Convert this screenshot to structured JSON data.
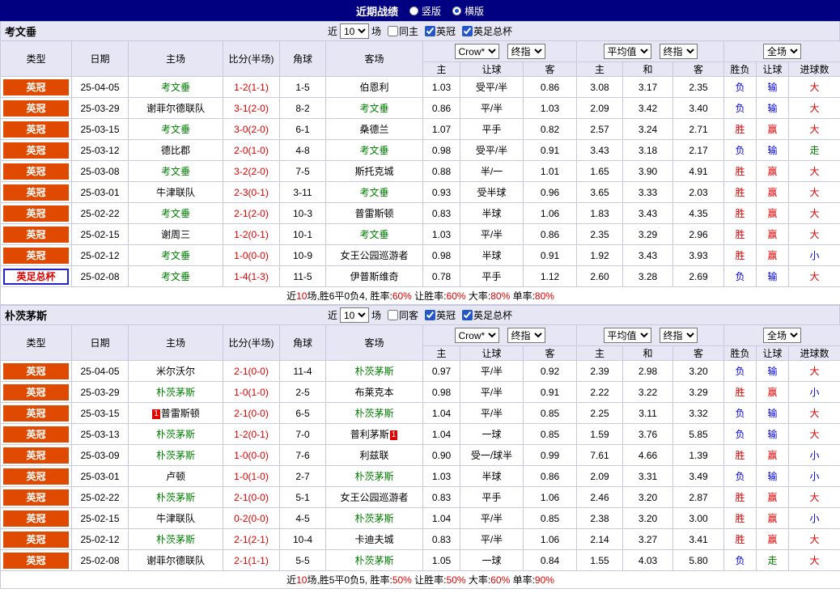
{
  "title_bar": {
    "title": "近期战绩",
    "options": [
      {
        "label": "竖版",
        "selected": false
      },
      {
        "label": "横版",
        "selected": true
      }
    ]
  },
  "colors": {
    "title_bar_bg": "#000080",
    "header_bg": "#E6E6F4",
    "league_badge": "#E04A00",
    "cup_border": "#2222CC",
    "focus_team_green": "#008000",
    "score_red": "#E00000",
    "loss_blue": "#0000E0",
    "push_green": "#008000"
  },
  "cup_type": "英足总杯",
  "result_colors": {
    "胜": "c-red",
    "负": "c-blue",
    "赢": "c-red",
    "输": "c-blue",
    "走": "c-green",
    "大": "c-red",
    "小": "c-blue"
  },
  "table_header": {
    "type": "类型",
    "date": "日期",
    "home": "主场",
    "score": "比分(半场)",
    "corner": "角球",
    "away": "客场",
    "odds_source": "Crow*",
    "final_index": "终指",
    "average": "平均值",
    "final_index2": "终指",
    "full": "全场",
    "subs": [
      "主",
      "让球",
      "客",
      "主",
      "和",
      "客",
      "胜负",
      "让球",
      "进球数"
    ]
  },
  "sections": [
    {
      "team": "考文垂",
      "filter": {
        "near": "近",
        "count": "10",
        "unit": "场",
        "same": {
          "label": "同主",
          "checked": false
        },
        "leagues": [
          {
            "label": "英冠",
            "checked": true
          },
          {
            "label": "英足总杯",
            "checked": true
          }
        ]
      },
      "rows": [
        {
          "type": "英冠",
          "date": "25-04-05",
          "home": "考文垂",
          "score": "1-2(1-1)",
          "corner": "1-5",
          "away": "伯恩利",
          "odds": [
            "1.03",
            "受平/半",
            "0.86",
            "3.08",
            "3.17",
            "2.35"
          ],
          "result": [
            "负",
            "输",
            "大"
          ]
        },
        {
          "type": "英冠",
          "date": "25-03-29",
          "home": "谢菲尔德联队",
          "score": "3-1(2-0)",
          "corner": "8-2",
          "away": "考文垂",
          "odds": [
            "0.86",
            "平/半",
            "1.03",
            "2.09",
            "3.42",
            "3.40"
          ],
          "result": [
            "负",
            "输",
            "大"
          ]
        },
        {
          "type": "英冠",
          "date": "25-03-15",
          "home": "考文垂",
          "score": "3-0(2-0)",
          "corner": "6-1",
          "away": "桑德兰",
          "odds": [
            "1.07",
            "平手",
            "0.82",
            "2.57",
            "3.24",
            "2.71"
          ],
          "result": [
            "胜",
            "赢",
            "大"
          ]
        },
        {
          "type": "英冠",
          "date": "25-03-12",
          "home": "德比郡",
          "score": "2-0(1-0)",
          "corner": "4-8",
          "away": "考文垂",
          "odds": [
            "0.98",
            "受平/半",
            "0.91",
            "3.43",
            "3.18",
            "2.17"
          ],
          "result": [
            "负",
            "输",
            "走"
          ]
        },
        {
          "type": "英冠",
          "date": "25-03-08",
          "home": "考文垂",
          "score": "3-2(2-0)",
          "corner": "7-5",
          "away": "斯托克城",
          "odds": [
            "0.88",
            "半/一",
            "1.01",
            "1.65",
            "3.90",
            "4.91"
          ],
          "result": [
            "胜",
            "赢",
            "大"
          ]
        },
        {
          "type": "英冠",
          "date": "25-03-01",
          "home": "牛津联队",
          "score": "2-3(0-1)",
          "corner": "3-11",
          "away": "考文垂",
          "odds": [
            "0.93",
            "受半球",
            "0.96",
            "3.65",
            "3.33",
            "2.03"
          ],
          "result": [
            "胜",
            "赢",
            "大"
          ]
        },
        {
          "type": "英冠",
          "date": "25-02-22",
          "home": "考文垂",
          "score": "2-1(2-0)",
          "corner": "10-3",
          "away": "普雷斯顿",
          "odds": [
            "0.83",
            "半球",
            "1.06",
            "1.83",
            "3.43",
            "4.35"
          ],
          "result": [
            "胜",
            "赢",
            "大"
          ]
        },
        {
          "type": "英冠",
          "date": "25-02-15",
          "home": "谢周三",
          "score": "1-2(0-1)",
          "corner": "10-1",
          "away": "考文垂",
          "odds": [
            "1.03",
            "平/半",
            "0.86",
            "2.35",
            "3.29",
            "2.96"
          ],
          "result": [
            "胜",
            "赢",
            "大"
          ]
        },
        {
          "type": "英冠",
          "date": "25-02-12",
          "home": "考文垂",
          "score": "1-0(0-0)",
          "corner": "10-9",
          "away": "女王公园巡游者",
          "odds": [
            "0.98",
            "半球",
            "0.91",
            "1.92",
            "3.43",
            "3.93"
          ],
          "result": [
            "胜",
            "赢",
            "小"
          ]
        },
        {
          "type": "英足总杯",
          "date": "25-02-08",
          "home": "考文垂",
          "score": "1-4(1-3)",
          "corner": "11-5",
          "away": "伊普斯维奇",
          "odds": [
            "0.78",
            "平手",
            "1.12",
            "2.60",
            "3.28",
            "2.69"
          ],
          "result": [
            "负",
            "输",
            "大"
          ]
        }
      ],
      "summary": [
        {
          "t": "近",
          "r": false
        },
        {
          "t": "10",
          "r": true
        },
        {
          "t": "场,胜6平0负4, 胜率:",
          "r": false
        },
        {
          "t": "60%",
          "r": true
        },
        {
          "t": " 让胜率:",
          "r": false
        },
        {
          "t": "60%",
          "r": true
        },
        {
          "t": " 大率:",
          "r": false
        },
        {
          "t": "80%",
          "r": true
        },
        {
          "t": " 单率:",
          "r": false
        },
        {
          "t": "80%",
          "r": true
        }
      ]
    },
    {
      "team": "朴茨茅斯",
      "filter": {
        "near": "近",
        "count": "10",
        "unit": "场",
        "same": {
          "label": "同客",
          "checked": false
        },
        "leagues": [
          {
            "label": "英冠",
            "checked": true
          },
          {
            "label": "英足总杯",
            "checked": true
          }
        ]
      },
      "rows": [
        {
          "type": "英冠",
          "date": "25-04-05",
          "home": "米尔沃尔",
          "score": "2-1(0-0)",
          "corner": "11-4",
          "away": "朴茨茅斯",
          "odds": [
            "0.97",
            "平/半",
            "0.92",
            "2.39",
            "2.98",
            "3.20"
          ],
          "result": [
            "负",
            "输",
            "大"
          ]
        },
        {
          "type": "英冠",
          "date": "25-03-29",
          "home": "朴茨茅斯",
          "score": "1-0(1-0)",
          "corner": "2-5",
          "away": "布莱克本",
          "odds": [
            "0.98",
            "平/半",
            "0.91",
            "2.22",
            "3.22",
            "3.29"
          ],
          "result": [
            "胜",
            "赢",
            "小"
          ]
        },
        {
          "type": "英冠",
          "date": "25-03-15",
          "home": "普雷斯顿",
          "home_card": "1",
          "home_card_pos": "before",
          "score": "2-1(0-0)",
          "corner": "6-5",
          "away": "朴茨茅斯",
          "odds": [
            "1.04",
            "平/半",
            "0.85",
            "2.25",
            "3.11",
            "3.32"
          ],
          "result": [
            "负",
            "输",
            "大"
          ]
        },
        {
          "type": "英冠",
          "date": "25-03-13",
          "home": "朴茨茅斯",
          "score": "1-2(0-1)",
          "corner": "7-0",
          "away": "普利茅斯",
          "away_card": "1",
          "away_card_pos": "after",
          "odds": [
            "1.04",
            "一球",
            "0.85",
            "1.59",
            "3.76",
            "5.85"
          ],
          "result": [
            "负",
            "输",
            "大"
          ]
        },
        {
          "type": "英冠",
          "date": "25-03-09",
          "home": "朴茨茅斯",
          "score": "1-0(0-0)",
          "corner": "7-6",
          "away": "利兹联",
          "odds": [
            "0.90",
            "受一/球半",
            "0.99",
            "7.61",
            "4.66",
            "1.39"
          ],
          "result": [
            "胜",
            "赢",
            "小"
          ]
        },
        {
          "type": "英冠",
          "date": "25-03-01",
          "home": "卢顿",
          "score": "1-0(1-0)",
          "corner": "2-7",
          "away": "朴茨茅斯",
          "odds": [
            "1.03",
            "半球",
            "0.86",
            "2.09",
            "3.31",
            "3.49"
          ],
          "result": [
            "负",
            "输",
            "小"
          ]
        },
        {
          "type": "英冠",
          "date": "25-02-22",
          "home": "朴茨茅斯",
          "score": "2-1(0-0)",
          "corner": "5-1",
          "away": "女王公园巡游者",
          "odds": [
            "0.83",
            "平手",
            "1.06",
            "2.46",
            "3.20",
            "2.87"
          ],
          "result": [
            "胜",
            "赢",
            "大"
          ]
        },
        {
          "type": "英冠",
          "date": "25-02-15",
          "home": "牛津联队",
          "score": "0-2(0-0)",
          "corner": "4-5",
          "away": "朴茨茅斯",
          "odds": [
            "1.04",
            "平/半",
            "0.85",
            "2.38",
            "3.20",
            "3.00"
          ],
          "result": [
            "胜",
            "赢",
            "小"
          ]
        },
        {
          "type": "英冠",
          "date": "25-02-12",
          "home": "朴茨茅斯",
          "score": "2-1(2-1)",
          "corner": "10-4",
          "away": "卡迪夫城",
          "odds": [
            "0.83",
            "平/半",
            "1.06",
            "2.14",
            "3.27",
            "3.41"
          ],
          "result": [
            "胜",
            "赢",
            "大"
          ]
        },
        {
          "type": "英冠",
          "date": "25-02-08",
          "home": "谢菲尔德联队",
          "score": "2-1(1-1)",
          "corner": "5-5",
          "away": "朴茨茅斯",
          "odds": [
            "1.05",
            "一球",
            "0.84",
            "1.55",
            "4.03",
            "5.80"
          ],
          "result": [
            "负",
            "走",
            "大"
          ]
        }
      ],
      "summary": [
        {
          "t": "近",
          "r": false
        },
        {
          "t": "10",
          "r": true
        },
        {
          "t": "场,胜5平0负5, 胜率:",
          "r": false
        },
        {
          "t": "50%",
          "r": true
        },
        {
          "t": " 让胜率:",
          "r": false
        },
        {
          "t": "50%",
          "r": true
        },
        {
          "t": " 大率:",
          "r": false
        },
        {
          "t": "60%",
          "r": true
        },
        {
          "t": " 单率:",
          "r": false
        },
        {
          "t": "90%",
          "r": true
        }
      ]
    }
  ]
}
